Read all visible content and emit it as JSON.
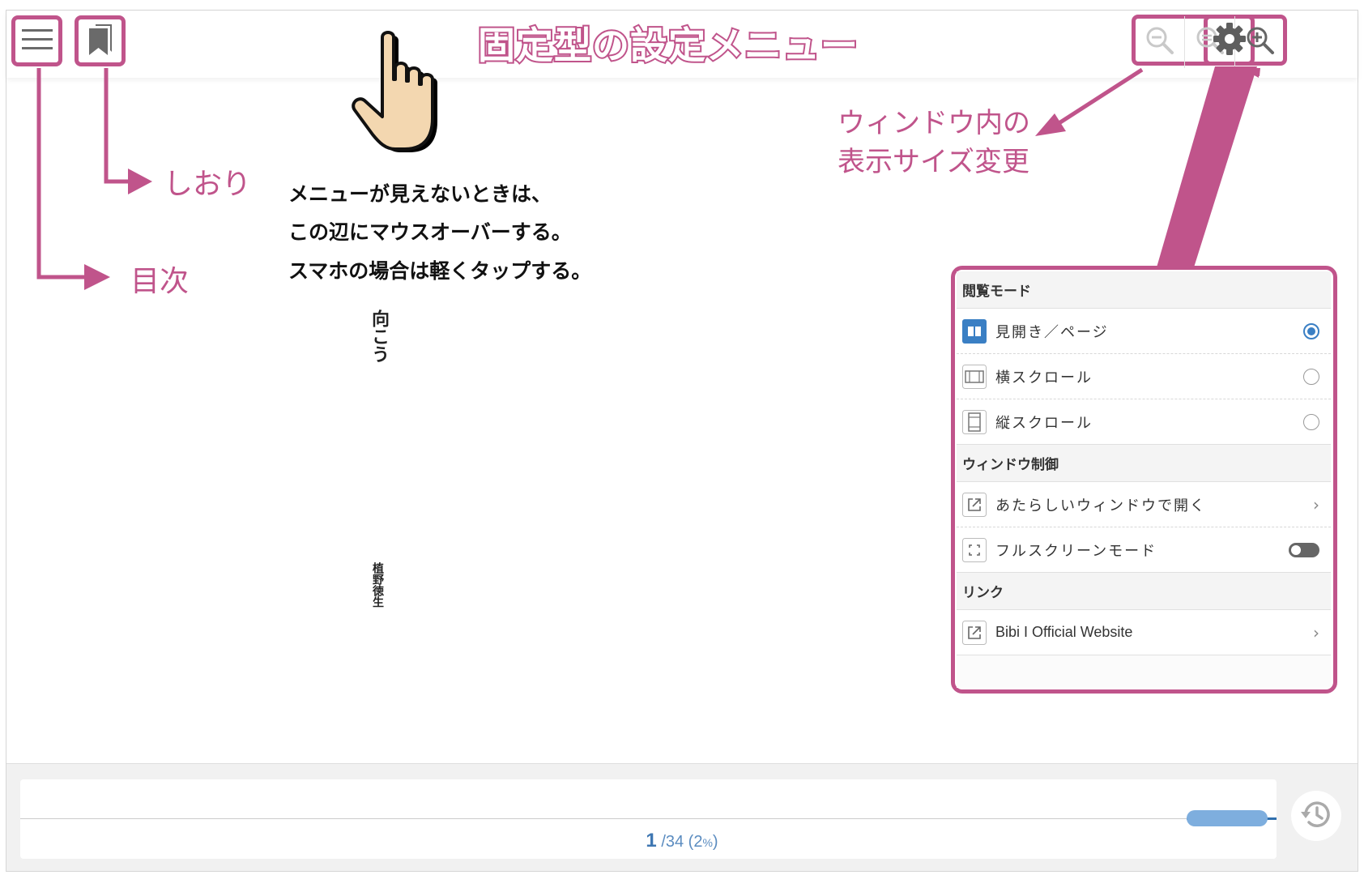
{
  "annotations": {
    "title": "固定型の設定メニュー",
    "bookmark_label": "しおり",
    "toc_label": "目次",
    "zoom_label_line1": "ウィンドウ内の",
    "zoom_label_line2": "表示サイズ変更",
    "instruction_line1": "メニューが見えないときは、",
    "instruction_line2": "この辺にマウスオーバーする。",
    "instruction_line3": "スマホの場合は軽くタップする。"
  },
  "toolbar": {
    "menu_icon": "hamburger-icon",
    "bookmark_icon": "bookmark-icon",
    "zoom_icons": [
      "zoom-out-icon",
      "zoom-reset-icon",
      "zoom-in-icon"
    ],
    "settings_icon": "gear-icon"
  },
  "book": {
    "title_vertical": "向こう",
    "author_vertical": "植野徳生"
  },
  "settings_panel": {
    "reading_mode": {
      "header": "閲覧モード",
      "options": [
        {
          "label": "見開き／ページ",
          "icon": "spread-page-icon",
          "selected": true
        },
        {
          "label": "横スクロール",
          "icon": "horizontal-scroll-icon",
          "selected": false
        },
        {
          "label": "縦スクロール",
          "icon": "vertical-scroll-icon",
          "selected": false
        }
      ]
    },
    "window_control": {
      "header": "ウィンドウ制御",
      "open_new_window": "あたらしいウィンドウで開く",
      "fullscreen": "フルスクリーンモード",
      "fullscreen_on": false
    },
    "links": {
      "header": "リンク",
      "items": [
        {
          "label": "Bibi I Official Website",
          "icon": "external-link-icon"
        }
      ]
    }
  },
  "footer": {
    "current_page": "1",
    "total_pages": "/34",
    "percent_open": " (",
    "percent_value": "2",
    "percent_unit": "%",
    "percent_close": ")",
    "progress_fraction": 0.02,
    "history_icon": "history-icon"
  },
  "colors": {
    "annotation_pink": "#c0548b",
    "accent_blue": "#3a7fc4",
    "page_text_blue": "#5b8cc0"
  }
}
